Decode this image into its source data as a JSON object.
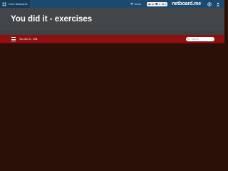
{
  "topbar": {
    "menu_label": "more Netboards",
    "share_label": "Share",
    "counters": [
      {
        "icon": "thumbs-up-icon",
        "value": "1k"
      },
      {
        "icon": "heart-icon",
        "value": "1"
      },
      {
        "icon": "eye-icon",
        "value": "1"
      }
    ],
    "brand": "netboard.me",
    "right_icons": [
      "globe-icon",
      "user-icon"
    ]
  },
  "banner": {
    "title": "You did it - exercises"
  },
  "navbar": {
    "board_label": "You did it - WB"
  },
  "search": {
    "placeholder": "Search"
  },
  "colors": {
    "topbar": "#1c4a6e",
    "banner": "#434648",
    "navbar": "#8e1010",
    "content": "#2b1008"
  }
}
